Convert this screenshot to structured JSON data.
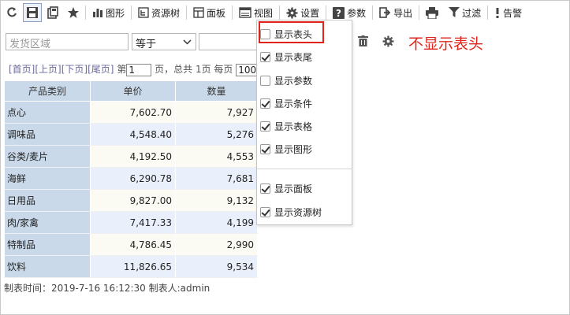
{
  "toolbar": {
    "items": [
      {
        "label": "图形",
        "icon": "bar-chart-icon"
      },
      {
        "label": "资源树",
        "icon": "tree-icon"
      },
      {
        "label": "面板",
        "icon": "panel-icon"
      },
      {
        "label": "视图",
        "icon": "view-icon"
      },
      {
        "label": "设置",
        "icon": "gear-icon"
      },
      {
        "label": "参数",
        "icon": "question-icon"
      },
      {
        "label": "导出",
        "icon": "export-icon"
      },
      {
        "label": "",
        "icon": "print-icon"
      },
      {
        "label": "过滤",
        "icon": "filter-icon"
      },
      {
        "label": "告警",
        "icon": "alert-icon"
      }
    ]
  },
  "filter": {
    "field_placeholder": "发货区域",
    "operator": "等于",
    "value": ""
  },
  "pager": {
    "first": "[首页]",
    "prev": "[上页]",
    "next": "[下页]",
    "last": "[尾页]",
    "page_prefix": "第",
    "page_value": "1",
    "page_suffix": "页，总共 1页 每页",
    "per_page": "1000"
  },
  "table": {
    "headers": [
      "产品类别",
      "单价",
      "数量"
    ],
    "rows": [
      [
        "点心",
        "7,602.70",
        "7,927"
      ],
      [
        "调味品",
        "4,548.40",
        "5,276"
      ],
      [
        "谷类/麦片",
        "4,192.50",
        "4,553"
      ],
      [
        "海鲜",
        "6,290.78",
        "7,681"
      ],
      [
        "日用品",
        "9,827.00",
        "9,132"
      ],
      [
        "肉/家禽",
        "7,417.33",
        "4,199"
      ],
      [
        "特制品",
        "4,786.45",
        "2,990"
      ],
      [
        "饮料",
        "11,826.65",
        "9,534"
      ]
    ]
  },
  "footer": "制表时间：2019-7-16 16:12:30 制表人:admin",
  "menu": {
    "items": [
      {
        "label": "显示表头",
        "checked": false
      },
      {
        "label": "显示表尾",
        "checked": true
      },
      {
        "label": "显示参数",
        "checked": false
      },
      {
        "label": "显示条件",
        "checked": true
      },
      {
        "label": "显示表格",
        "checked": true
      },
      {
        "label": "显示图形",
        "checked": true
      },
      {
        "label": "显示面板",
        "checked": true
      },
      {
        "label": "显示资源树",
        "checked": true
      }
    ]
  },
  "annotation": "不显示表头",
  "colors": {
    "accent_red": "#e0241b",
    "header_blue": "#c9d9ea"
  }
}
